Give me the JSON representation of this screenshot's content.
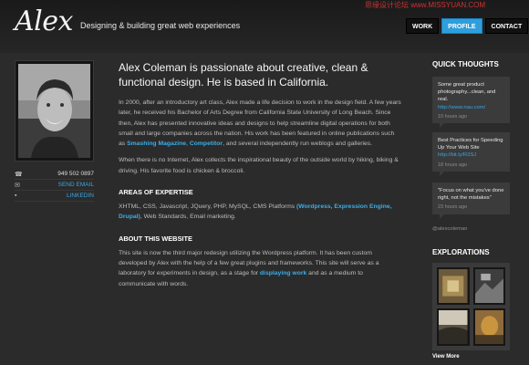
{
  "header": {
    "logo": "Alex",
    "tagline": "Designing & building great web experiences",
    "watermark": "思缘设计论坛 www.MISSYUAN.COM",
    "nav": [
      {
        "label": "WORK",
        "active": false
      },
      {
        "label": "PROFILE",
        "active": true
      },
      {
        "label": "CONTACT",
        "active": false
      }
    ]
  },
  "contact": {
    "phone": "949 502 0897",
    "email_label": "SEND EMAIL",
    "linkedin_label": "LINKEDIN"
  },
  "main": {
    "headline": "Alex Coleman is passionate about creative, clean & functional design. He is based in California.",
    "para1_text": "In 2000, after an introductory art class, Alex made a life decision to work in the design field. A few years later, he received his Bachelor of Arts Degree from California State University of Long Beach. Since then, Alex has presented innovative ideas and designs to help streamline digital operations for both small and large companies across the nation. His work has been featured in online publications such as ",
    "para1_link1": "Smashing Magazine",
    "para1_sep": ", ",
    "para1_link2": "Competitor",
    "para1_end": ", and several independently run weblogs and galleries.",
    "para2": "When there is no Internet, Alex collects the inspirational beauty of the outside world by hiking, biking & driving. His favorite food is chicken & broccoli.",
    "expertise_heading": "AREAS OF EXPERTISE",
    "expertise_text": "XHTML, CSS, Javascript, JQuery, PHP, MySQL, CMS Platforms ",
    "expertise_link": "(Wordpress, Expression Engine, Drupal)",
    "expertise_end": ", Web Standards, Email marketing.",
    "about_heading": "ABOUT THIS WEBSITE",
    "about_text": "This site is now the third major redesign utilizing the Wordpress platform. It has been custom developed by Alex with the help of a few great plugins and frameworks. This site will serve as a laboratory for experiments in design, as a stage for ",
    "about_link": "displaying work",
    "about_end": " and as a medium to communicate with words."
  },
  "sidebar": {
    "thoughts_title": "QUICK THOUGHTS",
    "tweets": [
      {
        "text": "Some great product photography...clean, and real.",
        "link": "http://www.nau.com/",
        "time": "10 hours ago"
      },
      {
        "text": "Best Practices for Speeding Up Your Web Site ",
        "link": "http://bit.ly/R3SJ",
        "time": "18 hours ago"
      },
      {
        "text": "\"Focus on what you've done right, not the mistakes\"",
        "link": "",
        "time": "23 hours ago"
      }
    ],
    "handle": "@alexcoleman",
    "explorations_title": "EXPLORATIONS",
    "view_more": "View More"
  },
  "colors": {
    "accent": "#2e9fdc",
    "link": "#3aaee8",
    "background": "#2b2b2b"
  }
}
